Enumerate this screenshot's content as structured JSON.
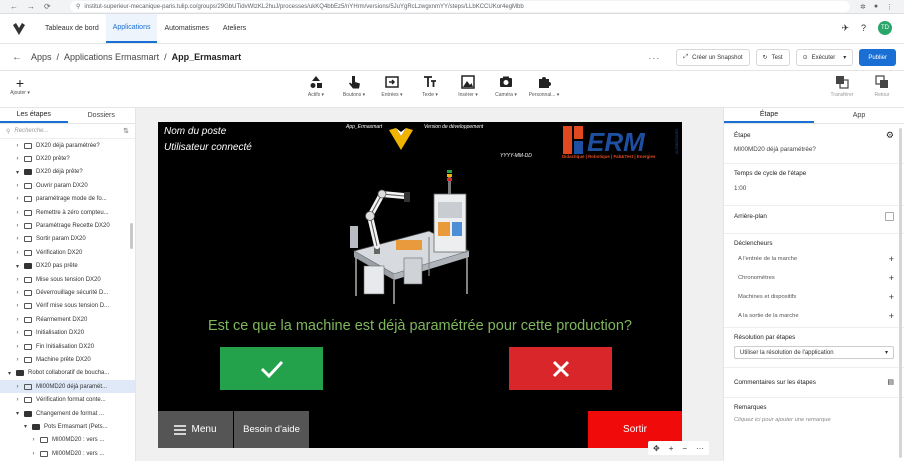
{
  "browser": {
    "url": "institut-superieur-mecanique-paris.tulip.co/groups/29GbUTidvWtzKL2huJ/processes/ukKQ4bbEz5/nYHrm/versions/5JuYgRcLzwgxnmYY/steps/LLbKCCUKor4egMbb",
    "nav_back_icon": "arrow-left-icon",
    "nav_forward_icon": "arrow-right-icon",
    "reload_icon": "reload-icon"
  },
  "top_nav": {
    "tabs": [
      {
        "label": "Tableaux de bord",
        "active": false
      },
      {
        "label": "Applications",
        "active": true
      },
      {
        "label": "Automatismes",
        "active": false
      },
      {
        "label": "Ateliers",
        "active": false
      }
    ],
    "user_initials": "TD",
    "accent": "#1a6fd4"
  },
  "breadcrumb": {
    "items": [
      "Apps",
      "Applications Ermasmart",
      "App_Ermasmart"
    ],
    "separator": "/",
    "more_label": "···",
    "snapshot_label": "Créer un Snapshot",
    "test_label": "Test",
    "run_label": "Exécuter",
    "publish_label": "Publier"
  },
  "toolbar": {
    "add_label": "Ajouter",
    "items": [
      {
        "label": "Actifs",
        "icon": "shapes-icon"
      },
      {
        "label": "Boutons",
        "icon": "pointer-icon"
      },
      {
        "label": "Entrées",
        "icon": "input-icon"
      },
      {
        "label": "Texte",
        "icon": "text-icon"
      },
      {
        "label": "Insérer",
        "icon": "image-icon"
      },
      {
        "label": "Caméra",
        "icon": "camera-icon"
      },
      {
        "label": "Personnal...",
        "icon": "puzzle-icon"
      }
    ],
    "right_items": [
      {
        "label": "Transférer",
        "icon": "bring-front-icon"
      },
      {
        "label": "Retour",
        "icon": "send-back-icon"
      }
    ]
  },
  "left_panel": {
    "tabs": [
      {
        "label": "Les étapes",
        "active": true
      },
      {
        "label": "Dossiers",
        "active": false
      }
    ],
    "search_placeholder": "Recherche...",
    "sort_icon": "⇅",
    "tree": [
      {
        "label": "DX20 déjà paramétrée?",
        "indent": 1,
        "type": "screen",
        "chev": ">"
      },
      {
        "label": "DX20 prête?",
        "indent": 1,
        "type": "screen",
        "chev": ">"
      },
      {
        "label": "DX20 déjà prête?",
        "indent": 1,
        "type": "folder",
        "chev": "v"
      },
      {
        "label": "Ouvrir param DX20",
        "indent": 1,
        "type": "screen",
        "chev": ">"
      },
      {
        "label": "paramétrage mode de fo...",
        "indent": 1,
        "type": "screen",
        "chev": ">"
      },
      {
        "label": "Remettre à zéro compteu...",
        "indent": 1,
        "type": "screen",
        "chev": ">"
      },
      {
        "label": "Paramétrage Recette DX20",
        "indent": 1,
        "type": "screen",
        "chev": ">"
      },
      {
        "label": "Sortir param DX20",
        "indent": 1,
        "type": "screen",
        "chev": ">"
      },
      {
        "label": "Vérification DX20",
        "indent": 1,
        "type": "screen",
        "chev": ">"
      },
      {
        "label": "DX20 pas prête",
        "indent": 1,
        "type": "folder",
        "chev": "v"
      },
      {
        "label": "Mise sous tension DX20",
        "indent": 1,
        "type": "screen",
        "chev": ">"
      },
      {
        "label": "Déverrouillage sécurité D...",
        "indent": 1,
        "type": "screen",
        "chev": ">"
      },
      {
        "label": "Vérif mise sous tension D...",
        "indent": 1,
        "type": "screen",
        "chev": ">"
      },
      {
        "label": "Réarmement DX20",
        "indent": 1,
        "type": "screen",
        "chev": ">"
      },
      {
        "label": "Initialisation DX20",
        "indent": 1,
        "type": "screen",
        "chev": ">"
      },
      {
        "label": "Fin Initialisation DX20",
        "indent": 1,
        "type": "screen",
        "chev": ">"
      },
      {
        "label": "Machine prête DX20",
        "indent": 1,
        "type": "screen",
        "chev": ">"
      },
      {
        "label": "Robot collaboratif de boucha...",
        "indent": 0,
        "type": "folder",
        "chev": "v"
      },
      {
        "label": "MI00MD20 déjà paramét...",
        "indent": 1,
        "type": "screen",
        "chev": ">",
        "selected": true
      },
      {
        "label": "Vérification format conte...",
        "indent": 1,
        "type": "screen",
        "chev": ">"
      },
      {
        "label": "Changement de format ...",
        "indent": 1,
        "type": "folder",
        "chev": "v"
      },
      {
        "label": "Pots Ermasmart (Pets...",
        "indent": 2,
        "type": "folder",
        "chev": "v"
      },
      {
        "label": "MI00MD20 : vers ...",
        "indent": 3,
        "type": "screen",
        "chev": ">"
      },
      {
        "label": "MI00MD20 : vers ...",
        "indent": 3,
        "type": "screen",
        "chev": ">"
      }
    ]
  },
  "screen": {
    "station_label": "Nom du poste",
    "user_label": "Utilisateur connecté",
    "app_label": "App_Ermasmart",
    "version_label": "Version de développement",
    "date_label": "YYYY-MM-DD",
    "erm_text": "ERM",
    "erm_side": "AUTOMATISMES",
    "erm_tagline": "Didactique | Robotique | Fab&Test | Energies",
    "question": "Est ce que la machine est déjà paramétrée pour cette production?",
    "yes_icon": "check-icon",
    "no_icon": "close-icon",
    "menu_label": "Menu",
    "help_label": "Besoin d'aide",
    "exit_label": "Sortir",
    "colors": {
      "question": "#7fb85c",
      "yes": "#23a14b",
      "no": "#d9262a",
      "exit": "#f00a0a",
      "erm_red": "#e0491f",
      "erm_blue": "#1e4fa0"
    }
  },
  "zoom": {
    "fit_icon": "✥",
    "plus": "+",
    "minus": "−",
    "more": "···"
  },
  "right_panel": {
    "tabs": [
      {
        "label": "Étape",
        "active": true
      },
      {
        "label": "App",
        "active": false
      }
    ],
    "step_title": "Étape",
    "step_name": "MI00MD20 déjà paramétrée?",
    "cycle_title": "Temps de cycle de l'étape",
    "cycle_value": "1:00",
    "background_title": "Arrière-plan",
    "triggers_title": "Déclencheurs",
    "triggers": [
      "A l'entrée de la marche",
      "Chronomètres",
      "Machines et dispositifs",
      "A la sortie de la marche"
    ],
    "resolution_title": "Résolution par étapes",
    "resolution_value": "Utiliser la résolution de l'application",
    "comments_title": "Commentaires sur les étapes",
    "notes_title": "Remarques",
    "notes_placeholder": "Cliquez ici pour ajouter une remarque"
  }
}
